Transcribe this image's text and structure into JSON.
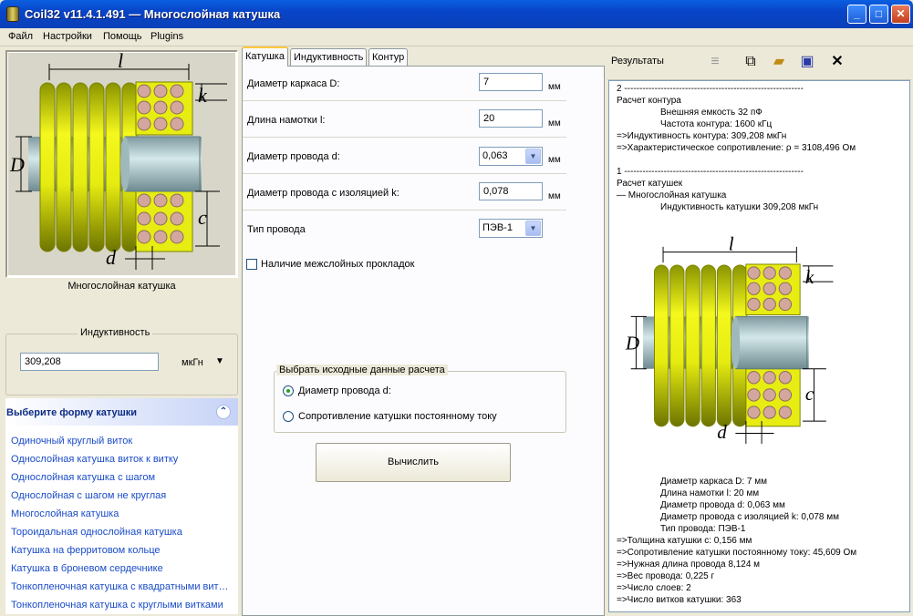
{
  "window": {
    "title": "Coil32 v11.4.1.491 — Многослойная катушка",
    "min_label": "_",
    "max_label": "□",
    "close_label": "✕"
  },
  "menu": [
    "Файл",
    "Настройки",
    "Помощь",
    "Plugins"
  ],
  "left": {
    "figure_caption": "Многослойная катушка",
    "diagram_labels": {
      "l": "l",
      "k": "k",
      "D": "D",
      "c": "c",
      "d": "d"
    },
    "inductance_group": "Индуктивность",
    "inductance_value": "309,208",
    "inductance_unit": "мкГн",
    "inductance_dropdown": "▼"
  },
  "task_pane": {
    "header": "Выберите форму катушки",
    "collapse_glyph": "⌃",
    "items": [
      "Одиночный круглый виток",
      "Однослойная катушка виток к витку",
      "Однослойная катушка с шагом",
      "Однослойная с шагом не круглая",
      "Многослойная катушка",
      "Тороидальная однослойная катушка",
      "Катушка на ферритовом кольце",
      "Катушка в броневом сердечнике",
      "Тонкопленочная катушка с квадратными вит…",
      "Тонкопленочная катушка с круглыми витками"
    ]
  },
  "tabs": [
    "Катушка",
    "Индуктивность",
    "Контур"
  ],
  "form": {
    "rows": [
      {
        "label": "Диаметр каркаса D:",
        "value": "7",
        "unit": "мм"
      },
      {
        "label": "Длина намотки l:",
        "value": "20",
        "unit": "мм"
      },
      {
        "label": "Диаметр провода d:",
        "value": "0,063",
        "unit": "мм"
      },
      {
        "label": "Диаметр провода с изоляцией k:",
        "value": "0,078",
        "unit": "мм"
      },
      {
        "label": "Тип провода",
        "value": "ПЭВ-1",
        "unit": ""
      }
    ],
    "spacer_checkbox": "Наличие межслойных прокладок",
    "source_group": "Выбрать исходные данные расчета",
    "radio_1": "Диаметр провода d:",
    "radio_2": "Сопротивление катушки постоянному току",
    "calc_button": "Вычислить"
  },
  "results_panel": {
    "title": "Результаты",
    "lines": [
      "2 -----------------------------------------------------------",
      "Расчет контура",
      "Внешняя емкость 32 пФ",
      "Частота контура: 1600 кГц",
      "=>Индуктивность контура: 309,208 мкГн",
      "=>Характеристическое сопротивление: ρ = 3108,496 Ом",
      "1 -----------------------------------------------------------",
      "Расчет катушек",
      "— Многослойная катушка",
      "Индуктивность катушки 309,208 мкГн",
      "Диаметр каркаса D: 7 мм",
      "Длина намотки l: 20 мм",
      "Диаметр провода d: 0,063 мм",
      "Диаметр провода с изоляцией k: 0,078 мм",
      "Тип провода: ПЭВ-1",
      "=>Толщина катушки c: 0,156 мм",
      "=>Сопротивление катушки постоянному току: 45,609 Ом",
      "=>Нужная длина провода 8,124 м",
      "=>Вес провода: 0,225 г",
      "=>Число слоев: 2",
      "=>Число витков катушки: 363"
    ]
  }
}
